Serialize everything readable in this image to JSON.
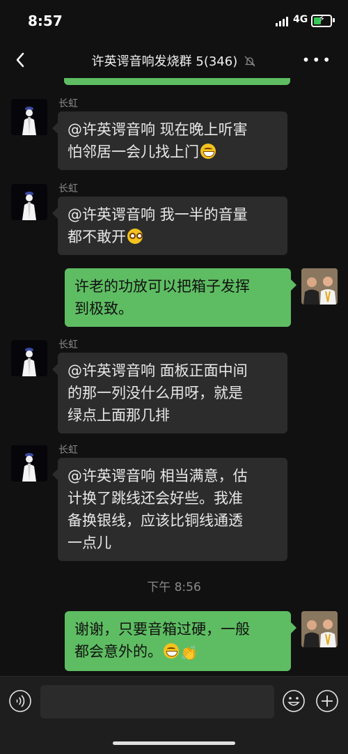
{
  "status": {
    "time": "8:57",
    "network": "4G"
  },
  "header": {
    "title": "许英谔音响发烧群 5(346)",
    "back_icon": "chevron-left-icon",
    "mute_icon": "bell-off-icon",
    "more_icon": "more-icon"
  },
  "messages": [
    {
      "sender": "长虹",
      "text": "@许英谔音响 现在晚上听害怕邻居一会儿找上门",
      "lines": [
        "@许英谔音响 现在晚上听害",
        "怕邻居一会儿找上门"
      ],
      "emoji": "grin-icon"
    },
    {
      "sender": "长虹",
      "text": "@许英谔音响 我一半的音量都不敢开",
      "lines": [
        "@许英谔音响 我一半的音量",
        "都不敢开"
      ],
      "emoji": "shocked-icon"
    },
    {
      "sender": "",
      "text": "许老的功放可以把箱子发挥到极致。",
      "lines": [
        "许老的功放可以把箱子发挥",
        "到极致。"
      ]
    },
    {
      "sender": "长虹",
      "text": "@许英谔音响 面板正面中间的那一列没什么用呀，就是绿点上面那几排",
      "lines": [
        "@许英谔音响 面板正面中间",
        "的那一列没什么用呀，就是",
        "绿点上面那几排"
      ]
    },
    {
      "sender": "长虹",
      "text": "@许英谔音响 相当满意，估计换了跳线还会好些。我准备换银线，应该比铜线通透一点儿",
      "lines": [
        "@许英谔音响 相当满意，估",
        "计换了跳线还会好些。我准",
        "备换银线，应该比铜线通透",
        "一点儿"
      ]
    },
    {
      "sender": "",
      "text": "谢谢，只要音箱过硬，一般都会意外的。",
      "lines": [
        "谢谢，只要音箱过硬，一般",
        "都会意外的。"
      ],
      "emoji": "grin-icon",
      "emoji2": "clap-icon"
    }
  ],
  "time_divider": "下午 8:56",
  "input": {
    "value": "",
    "voice_icon": "voice-icon",
    "emoji_icon": "smiley-icon",
    "plus_icon": "plus-circle-icon"
  },
  "colors": {
    "background": "#111111",
    "incoming_bubble": "#2c2c2c",
    "outgoing_bubble": "#5ebd62",
    "name_text": "#8a8a8a"
  }
}
